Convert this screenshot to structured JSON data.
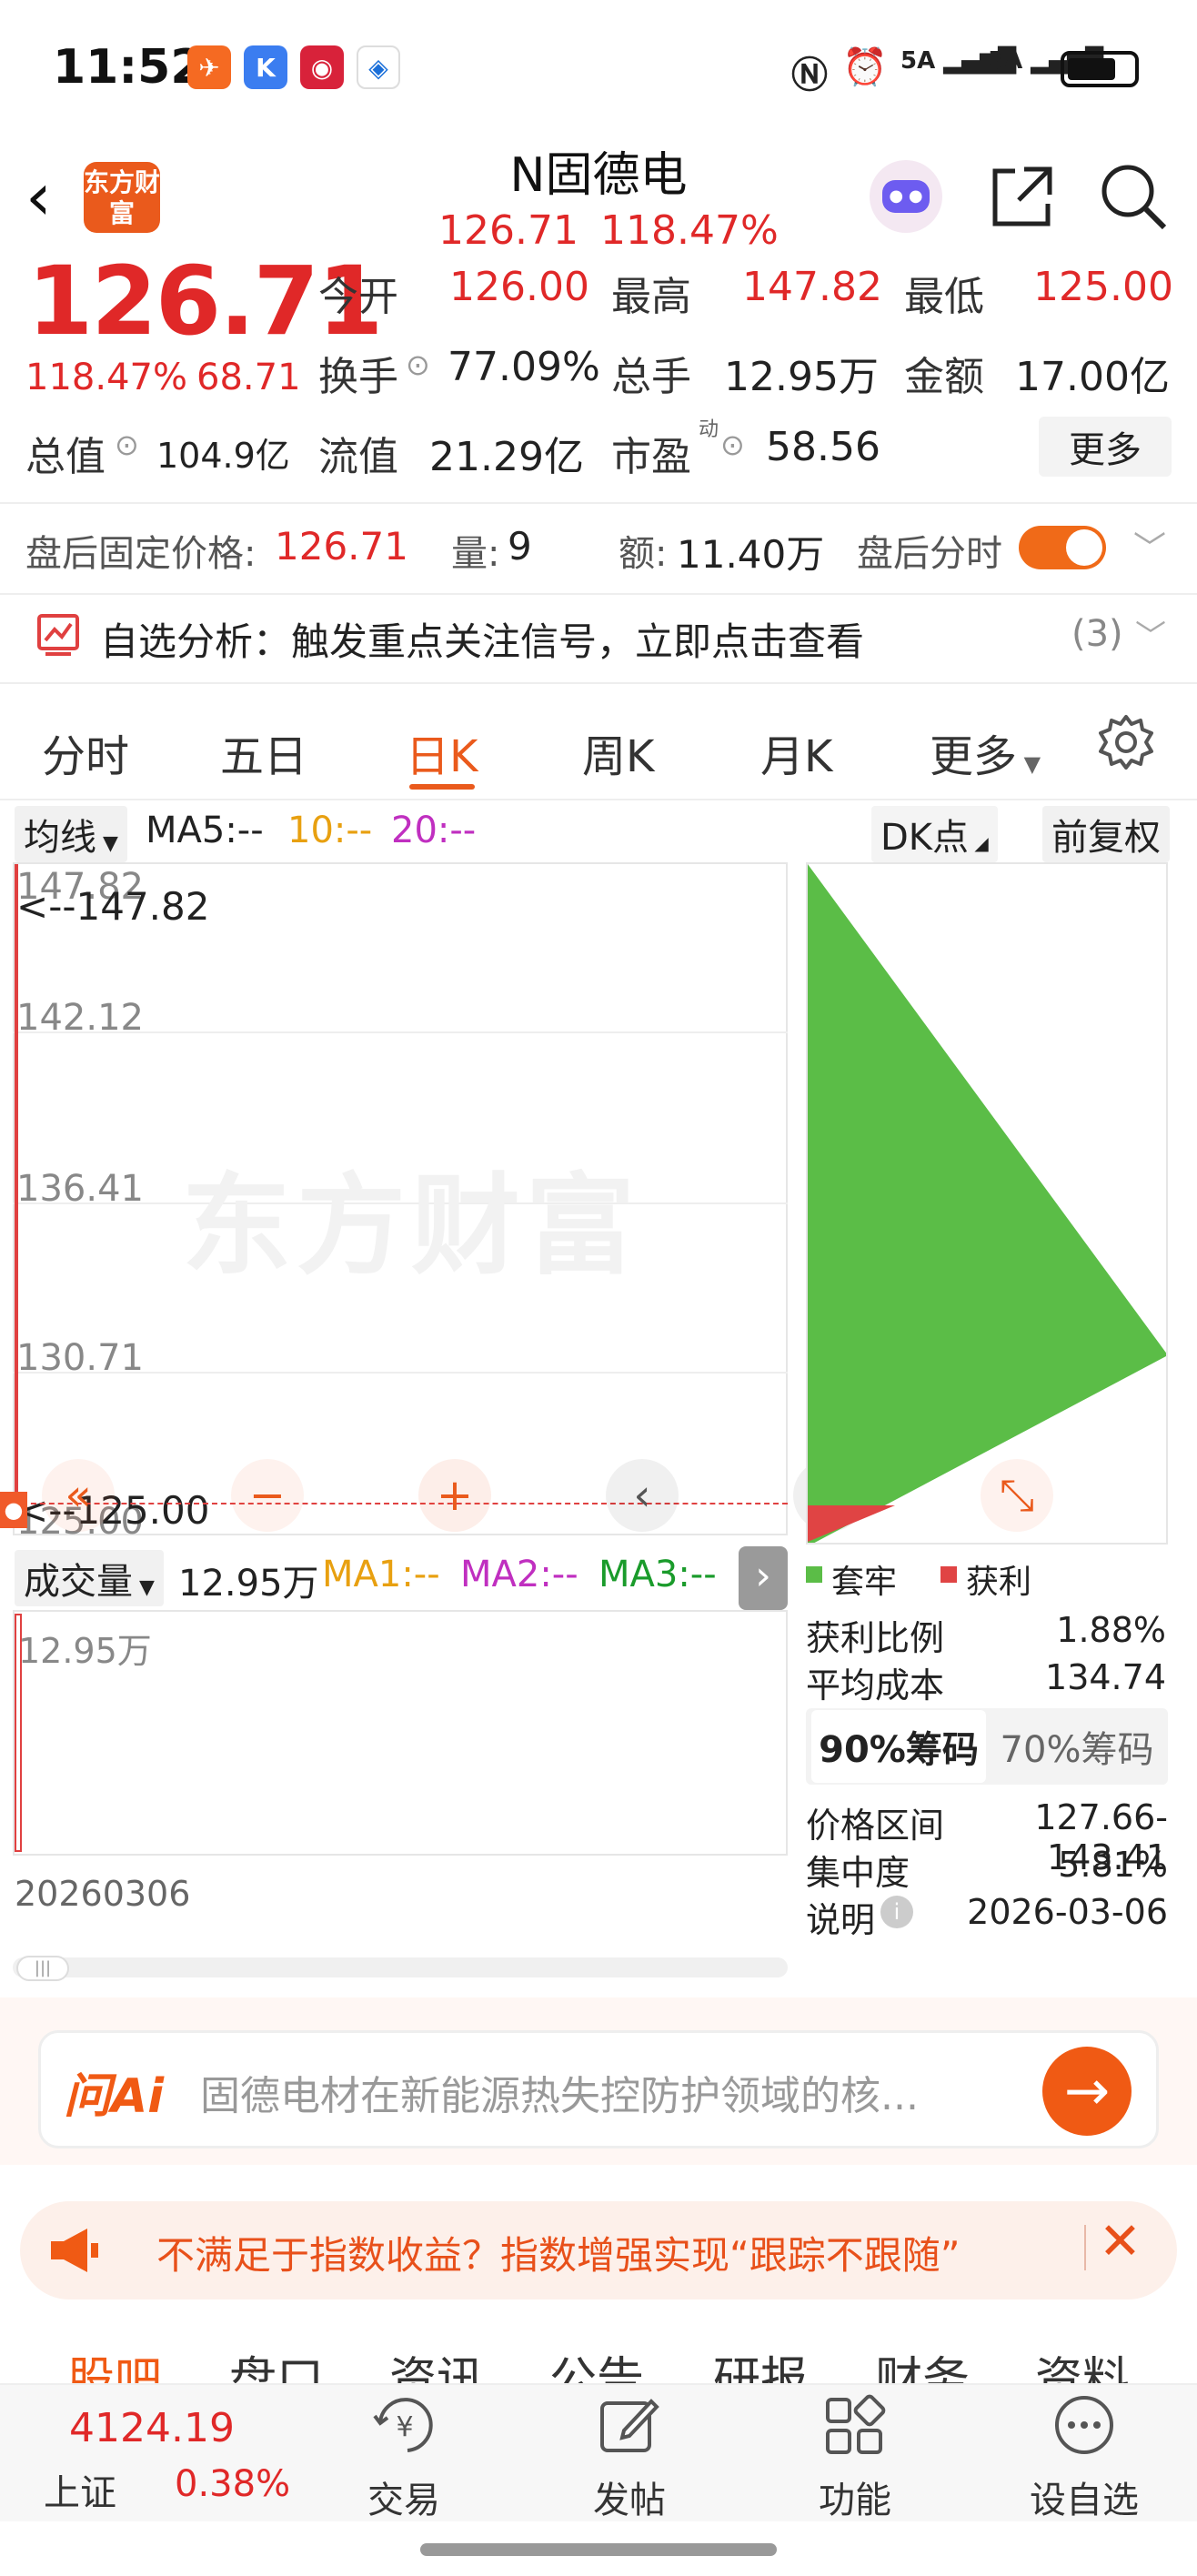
{
  "status_bar": {
    "time": "11:52",
    "signal1": "5A",
    "signal2": "5A"
  },
  "header": {
    "logo_text": "东方财富",
    "title": "N固德电",
    "price": "126.71",
    "change_pct": "118.47%"
  },
  "quote": {
    "price": "126.71",
    "change_pct": "118.47%",
    "change_amt": "68.71",
    "open_label": "今开",
    "open": "126.00",
    "high_label": "最高",
    "high": "147.82",
    "low_label": "最低",
    "low": "125.00",
    "turnover_label": "换手",
    "turnover": "77.09%",
    "volume_label": "总手",
    "volume": "12.95万",
    "amount_label": "金额",
    "amount": "17.00亿",
    "mktcap_label": "总值",
    "mktcap": "104.9亿",
    "float_label": "流值",
    "float_cap": "21.29亿",
    "pe_label": "市盈",
    "pe_sup": "动",
    "pe": "58.56",
    "more": "更多"
  },
  "after_hours": {
    "price_label": "盘后固定价格:",
    "price": "126.71",
    "vol_label": "量:",
    "vol": "9",
    "amt_label": "额:",
    "amt": "11.40万",
    "ts_label": "盘后分时"
  },
  "analysis": {
    "text": "自选分析：触发重点关注信号，立即点击查看",
    "count": "(3)"
  },
  "tabs": [
    "分时",
    "五日",
    "日K",
    "周K",
    "月K",
    "更多"
  ],
  "chart_toolbar": {
    "ma_select": "均线",
    "ma5": "MA5:--",
    "ma10": "10:--",
    "ma20": "20:--",
    "dk": "DK点",
    "adjust": "前复权"
  },
  "kline": {
    "y_labels": [
      "147.82",
      "142.12",
      "136.41",
      "130.71",
      "125.00"
    ],
    "high_marker": "<--147.82",
    "low_marker": "<--125.00",
    "watermark": "东方财富"
  },
  "volume_bar": {
    "select": "成交量",
    "value": "12.95万",
    "ma1": "MA1:--",
    "ma2": "MA2:--",
    "ma3": "MA3:--",
    "axis_label": "12.95万",
    "date": "20260306"
  },
  "chips": {
    "legend_locked": "套牢",
    "legend_profit": "获利",
    "profit_ratio_label": "获利比例",
    "profit_ratio": "1.88%",
    "avg_cost_label": "平均成本",
    "avg_cost": "134.74",
    "tab90": "90%筹码",
    "tab70": "70%筹码",
    "range_label": "价格区间",
    "range": "127.66-143.41",
    "concentration_label": "集中度",
    "concentration": "5.81%",
    "note_label": "说明",
    "date": "2026-03-06",
    "locked_color": "#5bbd47",
    "profit_color": "#e04444"
  },
  "ai": {
    "brand": "问Ai",
    "placeholder": "固德电材在新能源热失控防护领域的核..."
  },
  "banner": {
    "text": "不满足于指数收益？指数增强实现“跟踪不跟随”"
  },
  "bottom_tabs": [
    "股吧",
    "盘口",
    "资讯",
    "公告",
    "研报",
    "财务",
    "资料"
  ],
  "navbar": {
    "index_value": "4124.19",
    "index_name": "上证",
    "index_change": "0.38%",
    "trade": "交易",
    "post": "发帖",
    "func": "功能",
    "watch": "设自选"
  }
}
